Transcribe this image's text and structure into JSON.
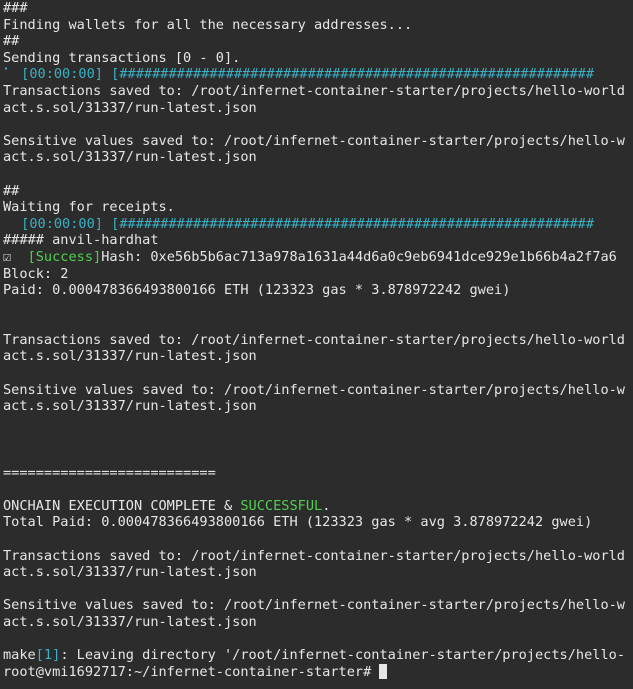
{
  "terminal": {
    "l01": "###",
    "l02": "Finding wallets for all the necessary addresses...",
    "l03": "##",
    "l04": "Sending transactions [0 - 0].",
    "progress1_prefix": "⠁ ",
    "progress1_time": "[00:00:00]",
    "progress1_bar": " [##########################################################",
    "l06": "Transactions saved to: /root/infernet-container-starter/projects/hello-world",
    "l07": "act.s.sol/31337/run-latest.json",
    "l09": "Sensitive values saved to: /root/infernet-container-starter/projects/hello-w",
    "l10": "act.s.sol/31337/run-latest.json",
    "l12": "##",
    "l13": "Waiting for receipts.",
    "progress2_prefix": "⠀ ",
    "progress2_time": "[00:00:00]",
    "progress2_bar": " [##########################################################",
    "l15": "##### anvil-hardhat",
    "check": "☑  ",
    "success_label": "[Success]",
    "hash": "Hash: 0xe56b5b6ac713a978a1631a44d6a0c9eb6941dce929e1b66b4a2f7a6",
    "l17": "Block: 2",
    "l18": "Paid: 0.000478366493800166 ETH (123323 gas * 3.878972242 gwei)",
    "l21": "Transactions saved to: /root/infernet-container-starter/projects/hello-world",
    "l22": "act.s.sol/31337/run-latest.json",
    "l24": "Sensitive values saved to: /root/infernet-container-starter/projects/hello-w",
    "l25": "act.s.sol/31337/run-latest.json",
    "l29": "==========================",
    "l31_pre": "ONCHAIN EXECUTION COMPLETE & ",
    "l31_success": "SUCCESSFUL",
    "l31_post": ".",
    "l32": "Total Paid: 0.000478366493800166 ETH (123323 gas * avg 3.878972242 gwei)",
    "l34": "Transactions saved to: /root/infernet-container-starter/projects/hello-world",
    "l35": "act.s.sol/31337/run-latest.json",
    "l37": "Sensitive values saved to: /root/infernet-container-starter/projects/hello-w",
    "l38": "act.s.sol/31337/run-latest.json",
    "make_pre": "make",
    "make_num": "[1]",
    "make_post": ": Leaving directory '/root/infernet-container-starter/projects/hello-",
    "prompt": "root@vmi1692717:~/infernet-container-starter# "
  },
  "colors": {
    "background": "#2c2c2c",
    "text": "#e6e6e6",
    "accent_cyan": "#3ab0c4",
    "success_green": "#4fd14f"
  }
}
